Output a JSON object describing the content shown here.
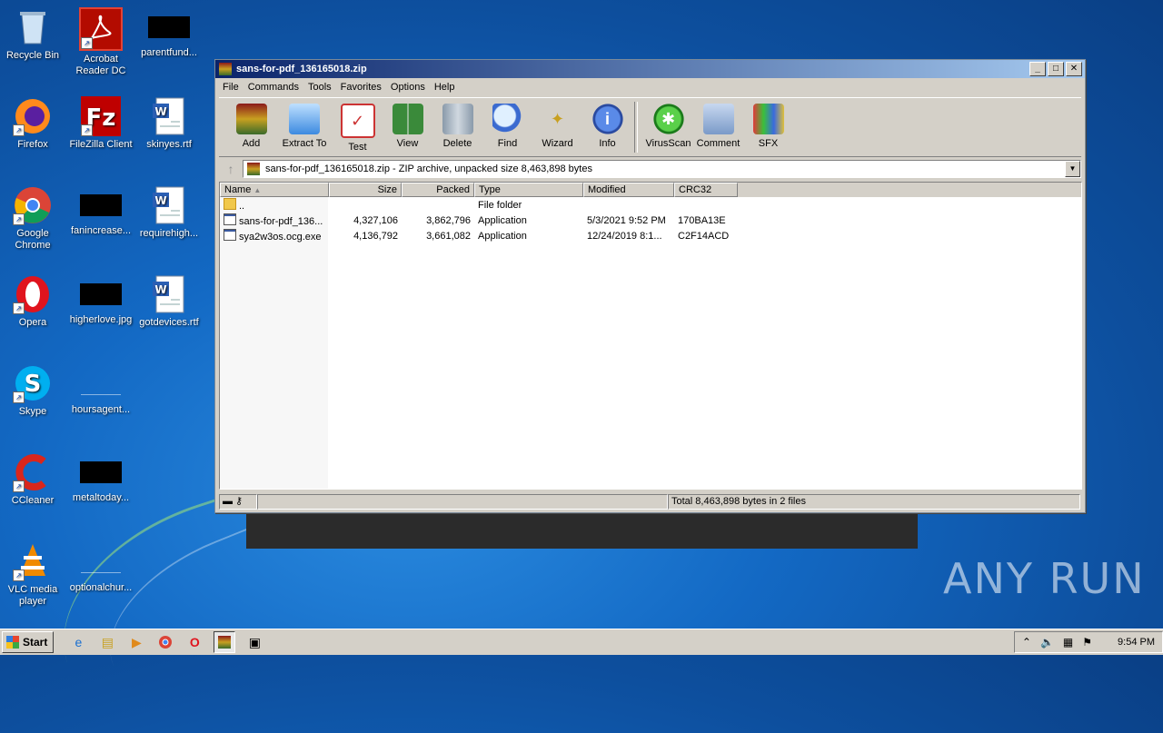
{
  "desktop": {
    "icons": [
      {
        "label": "Recycle Bin"
      },
      {
        "label": "Acrobat Reader DC"
      },
      {
        "label": "parentfund..."
      },
      {
        "label": "Firefox"
      },
      {
        "label": "FileZilla Client"
      },
      {
        "label": "skinyes.rtf"
      },
      {
        "label": "Google Chrome"
      },
      {
        "label": "fanincrease..."
      },
      {
        "label": "requirehigh..."
      },
      {
        "label": "Opera"
      },
      {
        "label": "higherlove.jpg"
      },
      {
        "label": "gotdevices.rtf"
      },
      {
        "label": "Skype"
      },
      {
        "label": "hoursagent..."
      },
      {
        "label": "CCleaner"
      },
      {
        "label": "metaltoday..."
      },
      {
        "label": "VLC media player"
      },
      {
        "label": "optionalchur..."
      }
    ],
    "watermark": "ANY RUN"
  },
  "window": {
    "title": "sans-for-pdf_136165018.zip",
    "menu": [
      "File",
      "Commands",
      "Tools",
      "Favorites",
      "Options",
      "Help"
    ],
    "toolbar": [
      "Add",
      "Extract To",
      "Test",
      "View",
      "Delete",
      "Find",
      "Wizard",
      "Info",
      "VirusScan",
      "Comment",
      "SFX"
    ],
    "path": "sans-for-pdf_136165018.zip - ZIP archive, unpacked size 8,463,898 bytes",
    "columns": [
      "Name",
      "Size",
      "Packed",
      "Type",
      "Modified",
      "CRC32"
    ],
    "rows": [
      {
        "name": "..",
        "size": "",
        "packed": "",
        "type": "File folder",
        "modified": "",
        "crc": ""
      },
      {
        "name": "sans-for-pdf_136...",
        "size": "4,327,106",
        "packed": "3,862,796",
        "type": "Application",
        "modified": "5/3/2021 9:52 PM",
        "crc": "170BA13E"
      },
      {
        "name": "sya2w3os.ocg.exe",
        "size": "4,136,792",
        "packed": "3,661,082",
        "type": "Application",
        "modified": "12/24/2019 8:1...",
        "crc": "C2F14ACD"
      }
    ],
    "status": "Total 8,463,898 bytes in 2 files"
  },
  "taskbar": {
    "start": "Start",
    "clock": "9:54 PM"
  }
}
